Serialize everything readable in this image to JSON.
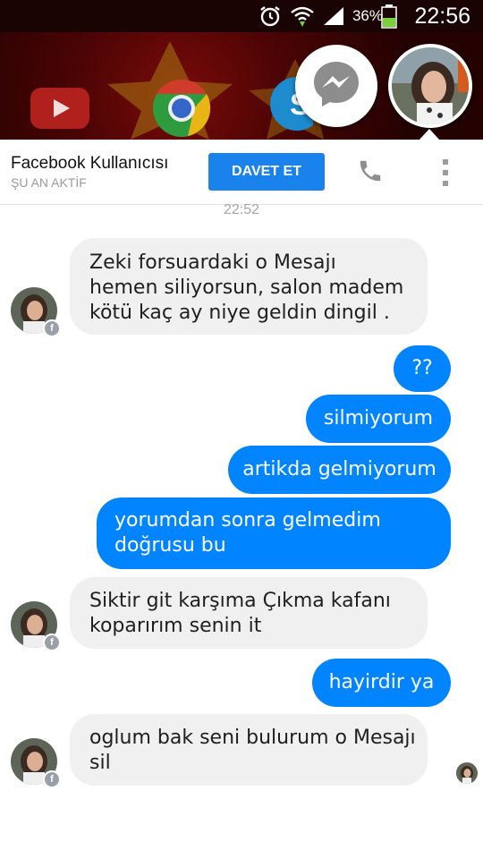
{
  "status_bar": {
    "time": "22:56",
    "battery_percent": "36%",
    "icons": [
      "alarm-icon",
      "wifi-icon",
      "signal-icon",
      "battery-icon"
    ]
  },
  "home_screen": {
    "app_icons": [
      "youtube-icon",
      "chrome-icon",
      "skype-icon"
    ]
  },
  "chat_heads": {
    "messenger_icon": "messenger-icon",
    "profile_avatar": "profile-avatar"
  },
  "header": {
    "contact_name": "Facebook Kullanıcısı",
    "status": "ŞU AN AKTİF",
    "invite_label": "DAVET ET",
    "call_icon": "phone-icon",
    "more_icon": "more-vertical-icon"
  },
  "conversation": {
    "timestamp": "22:52",
    "messages": [
      {
        "direction": "incoming",
        "lines": [
          "Zeki forsuardaki o Mesajı",
          "hemen siliyorsun, salon madem",
          "kötü kaç ay niye geldin dingil ."
        ]
      },
      {
        "direction": "outgoing",
        "lines": [
          "??"
        ]
      },
      {
        "direction": "outgoing",
        "lines": [
          "silmiyorum"
        ]
      },
      {
        "direction": "outgoing",
        "lines": [
          "artikda gelmiyorum"
        ]
      },
      {
        "direction": "outgoing",
        "lines": [
          "yorumdan sonra gelmedim",
          "doğrusu bu"
        ]
      },
      {
        "direction": "incoming",
        "lines": [
          "Siktir git karşıma Çıkma kafanı",
          "koparırım senin it"
        ]
      },
      {
        "direction": "outgoing",
        "lines": [
          "hayirdir ya"
        ]
      },
      {
        "direction": "incoming",
        "lines": [
          "oglum bak seni bulurum o Mesajı",
          "sil"
        ]
      }
    ]
  },
  "colors": {
    "accent": "#0084ff",
    "invite_button": "#1a82ec",
    "incoming_bubble": "#f0f0f0"
  }
}
